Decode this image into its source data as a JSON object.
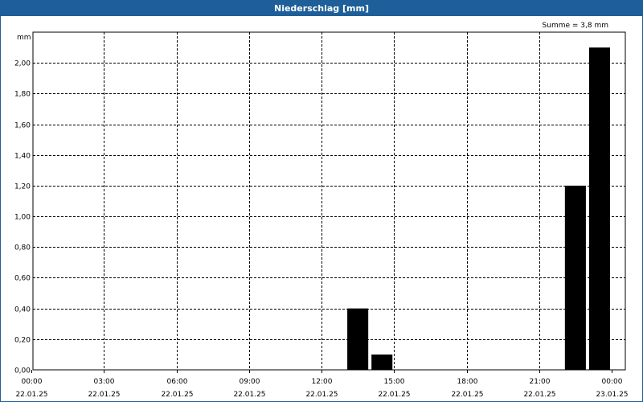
{
  "window": {
    "title": "Niederschlag [mm]"
  },
  "chart_data": {
    "type": "bar",
    "ylabel": "mm",
    "annotation": "Summe = 3,8 mm",
    "ylim": [
      0,
      2.2
    ],
    "yticks": [
      "0,00",
      "0,20",
      "0,40",
      "0,60",
      "0,80",
      "1,00",
      "1,20",
      "1,40",
      "1,60",
      "1,80",
      "2,00"
    ],
    "xlim_hours": [
      0,
      24
    ],
    "xticks": [
      {
        "time": "00:00",
        "date": "22.01.25"
      },
      {
        "time": "03:00",
        "date": "22.01.25"
      },
      {
        "time": "06:00",
        "date": "22.01.25"
      },
      {
        "time": "09:00",
        "date": "22.01.25"
      },
      {
        "time": "12:00",
        "date": "22.01.25"
      },
      {
        "time": "15:00",
        "date": "22.01.25"
      },
      {
        "time": "18:00",
        "date": "22.01.25"
      },
      {
        "time": "21:00",
        "date": "22.01.25"
      },
      {
        "time": "00:00",
        "date": "23.01.25"
      }
    ],
    "bars": [
      {
        "start": "13:00",
        "end": "14:00",
        "value": 0.4
      },
      {
        "start": "14:00",
        "end": "15:00",
        "value": 0.1
      },
      {
        "start": "22:00",
        "end": "23:00",
        "value": 1.2
      },
      {
        "start": "23:00",
        "end": "24:00",
        "value": 2.1
      }
    ],
    "grid": true,
    "bar_color": "#000000"
  }
}
